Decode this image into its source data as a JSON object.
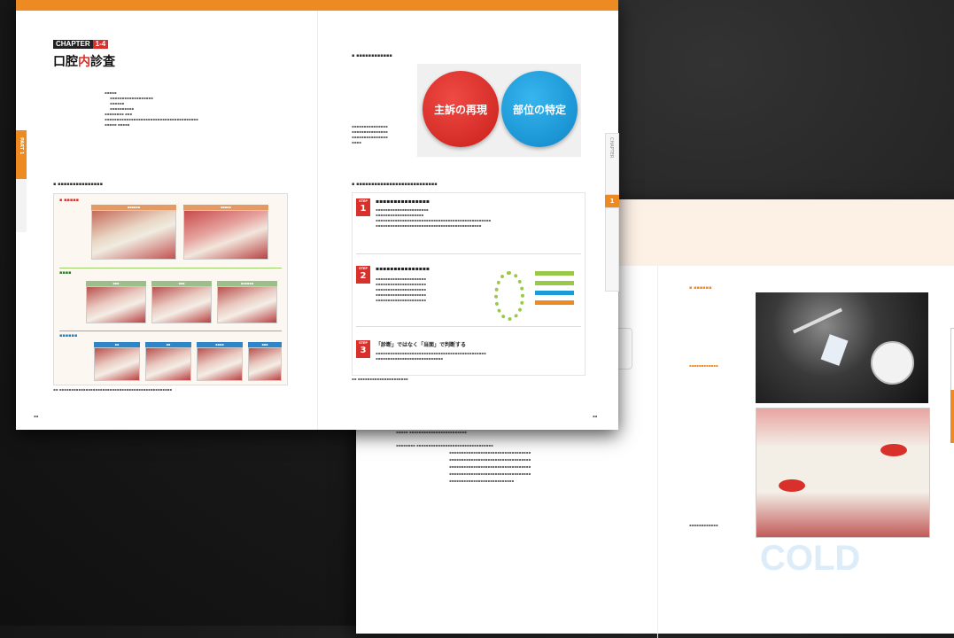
{
  "front": {
    "chapter_label": "CHAPTER",
    "chapter_number": "1-4",
    "title_pre": "口腔",
    "title_accent": "内",
    "title_post": "診査",
    "part_label": "PART 1",
    "side_right": "CHAPTER",
    "side_right_num": "1",
    "circle_left": "主訴の再現",
    "circle_right": "部位の特定",
    "step_labels": [
      "STEP",
      "STEP",
      "STEP"
    ],
    "step_numbers": [
      "1",
      "2",
      "3"
    ],
    "step3_title": "「診断」ではなく「当面」で判断する"
  },
  "back": {
    "bottom_word": "COLD"
  },
  "colors": {
    "orange": "#ed8a22",
    "red": "#d8312c",
    "blue": "#1b9bd8"
  }
}
